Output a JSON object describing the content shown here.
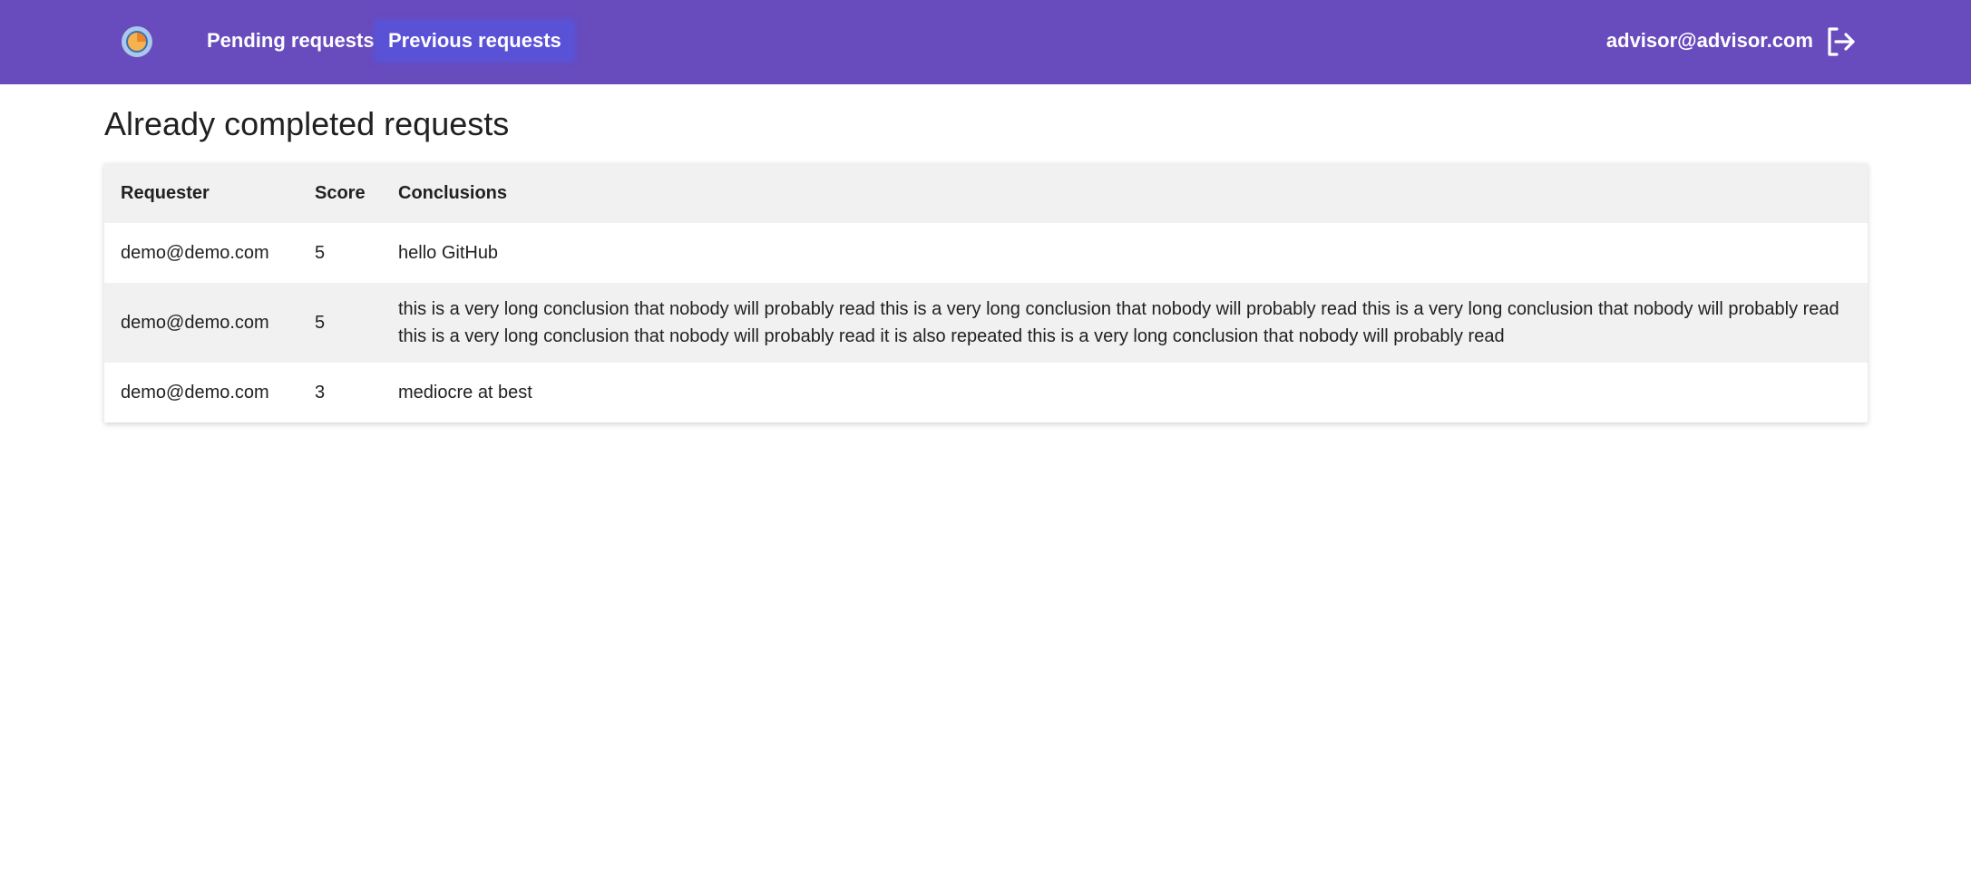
{
  "header": {
    "logo_icon": "app-logo-icon",
    "nav": [
      {
        "label": "Pending requests",
        "active": false
      },
      {
        "label": "Previous requests",
        "active": true
      }
    ],
    "user_email": "advisor@advisor.com",
    "logout_icon": "logout-icon",
    "colors": {
      "bar": "#684bbd",
      "active_tab": "#5a52d6"
    }
  },
  "main": {
    "title": "Already completed requests",
    "table": {
      "columns": [
        "Requester",
        "Score",
        "Conclusions"
      ],
      "rows": [
        {
          "requester": "demo@demo.com",
          "score": "5",
          "conclusion": "hello GitHub"
        },
        {
          "requester": "demo@demo.com",
          "score": "5",
          "conclusion": "this is a very long conclusion that nobody will probably read this is a very long conclusion that nobody will probably read this is a very long conclusion that nobody will probably read this is a very long conclusion that nobody will probably read it is also repeated this is a very long conclusion that nobody will probably read"
        },
        {
          "requester": "demo@demo.com",
          "score": "3",
          "conclusion": "mediocre at best"
        }
      ]
    }
  }
}
